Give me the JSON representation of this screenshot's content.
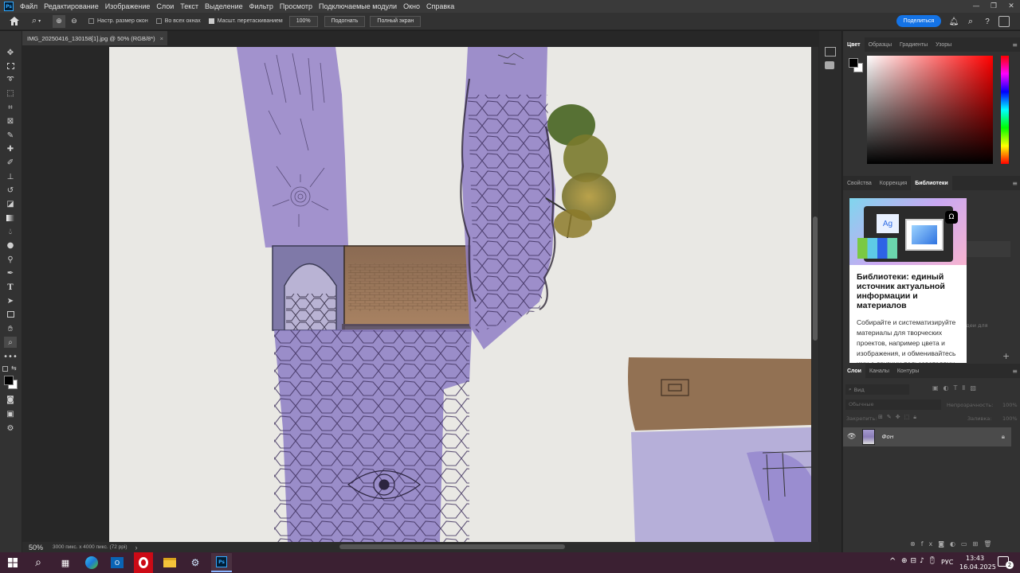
{
  "menubar": {
    "app_logo": "Ps",
    "items": [
      "Файл",
      "Редактирование",
      "Изображение",
      "Слои",
      "Текст",
      "Выделение",
      "Фильтр",
      "Просмотр",
      "Подключаемые модули",
      "Окно",
      "Справка"
    ]
  },
  "options_bar": {
    "checkbox_resize": "Настр. размер окон",
    "checkbox_all_windows": "Во всех окнах",
    "checkbox_scrubby": "Масшт. перетаскиванием",
    "zoom_value": "100%",
    "fit_button": "Подогнать",
    "fullscreen_button": "Полный экран",
    "share_button": "Поделиться"
  },
  "document": {
    "tab_title": "IMG_20250416_130158[1].jpg @ 50% (RGB/8*)",
    "tab_close": "×",
    "zoom": "50%",
    "size_info": "3000 пикс. x 4000 пикс. (72 ppi)",
    "status_arrow": "›"
  },
  "color_panel": {
    "tabs": [
      "Цвет",
      "Образцы",
      "Градиенты",
      "Узоры"
    ],
    "active_tab": "Цвет",
    "foreground": "#000000",
    "background": "#ffffff",
    "hue": "#ff0000"
  },
  "libraries_panel": {
    "tabs": [
      "Свойства",
      "Коррекция",
      "Библиотеки"
    ],
    "active_tab": "Библиотеки",
    "card_sample_text": "Ag",
    "heading": "Библиотеки: единый источник актуальной информации и материалов",
    "body": "Собирайте и систематизируйте материалы для творческих проектов, например цвета и изображения, и обменивайтесь ими с другими пользователями",
    "behind_text": "идеи для"
  },
  "layers_panel": {
    "tabs": [
      "Слои",
      "Каналы",
      "Контуры"
    ],
    "active_tab": "Слои",
    "filter_label": "Вид",
    "blend_mode": "Обычные",
    "opacity_label": "Непрозрачность:",
    "opacity_value": "100%",
    "lock_label": "Закрепить:",
    "fill_label": "Заливка:",
    "fill_value": "100%",
    "layers": [
      {
        "name": "Фон",
        "visible": true,
        "locked": true
      }
    ]
  },
  "taskbar": {
    "language": "РУС",
    "time": "13:43",
    "date": "16.04.2025",
    "notifications": "2"
  }
}
